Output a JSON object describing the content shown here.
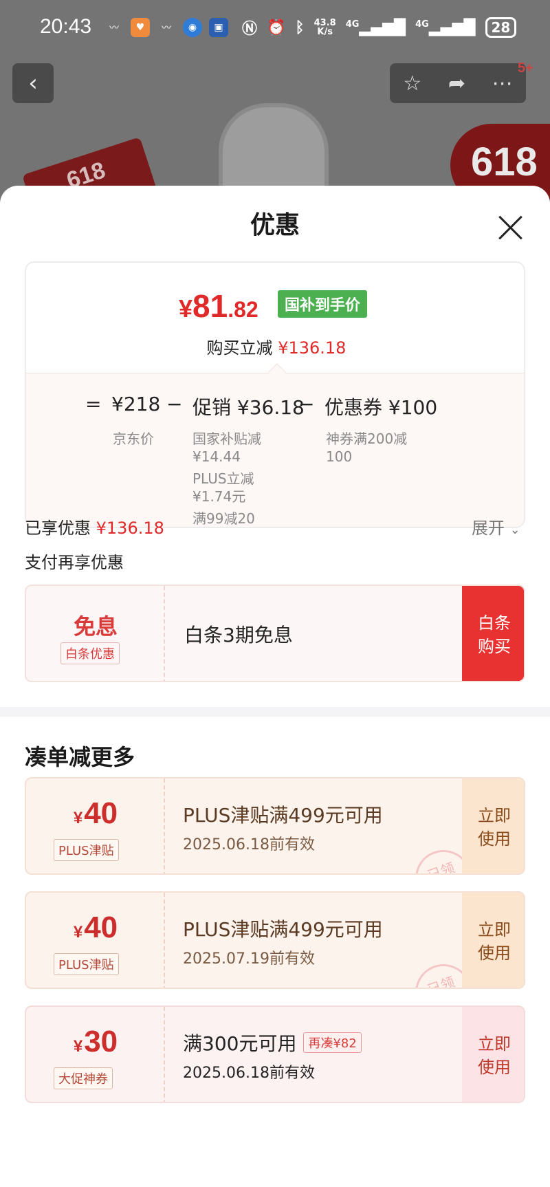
{
  "status_bar": {
    "time": "20:43",
    "net_speed_value": "43.8",
    "net_speed_unit": "K/s",
    "signal_1": "4G",
    "signal_2": "4G",
    "battery": "28"
  },
  "nav": {
    "back_icon": "‹",
    "cart_badge": "5+"
  },
  "background": {
    "badge_left": "618",
    "badge_right": "618"
  },
  "sheet": {
    "title": "优惠"
  },
  "price_card": {
    "yen": "¥",
    "integer": "81",
    "decimal": ".82",
    "tag": "国补到手价",
    "sub_label": "购买立减",
    "sub_value": "¥136.18",
    "formula": {
      "eq": "=",
      "jd_price": "¥218",
      "minus1": "−",
      "promo": "促销 ¥36.18",
      "minus2": "−",
      "coupon": "优惠券 ¥100"
    },
    "jd_price_label": "京东价",
    "promo_details": [
      "国家补贴减",
      "¥14.44",
      "PLUS立减",
      "¥1.74元",
      "满99减20"
    ],
    "coupon_details": [
      "神券满200减",
      "100"
    ]
  },
  "enjoyed": {
    "label": "已享优惠",
    "value": "¥136.18",
    "expand": "展开"
  },
  "pay_more": "支付再享优惠",
  "baitiao": {
    "big": "免息",
    "small": "白条优惠",
    "desc": "白条3期免息",
    "button_line1": "白条",
    "button_line2": "购买"
  },
  "section_title": "凑单减更多",
  "coupons": [
    {
      "yen": "¥",
      "amount": "40",
      "tag": "PLUS津贴",
      "title": "PLUS津贴满499元可用",
      "date": "2025.06.18前有效",
      "stamp": "已领",
      "button_line1": "立即",
      "button_line2": "使用"
    },
    {
      "yen": "¥",
      "amount": "40",
      "tag": "PLUS津贴",
      "title": "PLUS津贴满499元可用",
      "date": "2025.07.19前有效",
      "stamp": "已领",
      "button_line1": "立即",
      "button_line2": "使用"
    },
    {
      "yen": "¥",
      "amount": "30",
      "tag": "大促神券",
      "title": "满300元可用",
      "extra": "再凑¥82",
      "date": "2025.06.18前有效",
      "button_line1": "立即",
      "button_line2": "使用"
    }
  ]
}
